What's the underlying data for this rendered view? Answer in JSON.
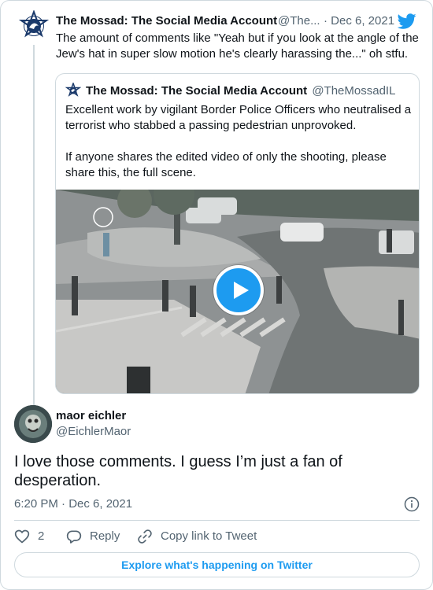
{
  "parent_tweet": {
    "author_name": "The Mossad: The Social Media Account",
    "handle": "@The...",
    "date": "· Dec 6, 2021",
    "text": "The amount of comments like \"Yeah but if you look at the angle of the Jew's hat in super slow motion he's clearly harassing the...\" oh stfu.",
    "avatar_icon": "mossad-emblem-icon"
  },
  "quoted_tweet": {
    "author_name": "The Mossad: The Social Media Account",
    "handle": "@TheMossadIL",
    "text_paragraph_1": "Excellent work by vigilant Border Police Officers who neutralised a terrorist who stabbed a passing pedestrian unprovoked.",
    "text_paragraph_2": "If anyone shares the edited video of only the shooting, please share this, the full scene.",
    "media": {
      "type": "video",
      "play_icon": "play-icon"
    }
  },
  "main_tweet": {
    "author_name": "maor eichler",
    "handle": "@EichlerMaor",
    "text": "I love those comments. I guess I’m just a fan of desperation.",
    "timestamp": "6:20 PM · Dec 6, 2021"
  },
  "actions": {
    "like_count": "2",
    "reply_label": "Reply",
    "copy_link_label": "Copy link to Tweet"
  },
  "explore_button_label": "Explore what's happening on Twitter",
  "colors": {
    "accent": "#1d9bf0",
    "text_primary": "#0f1419",
    "text_secondary": "#536471",
    "border": "#cfd9de"
  }
}
